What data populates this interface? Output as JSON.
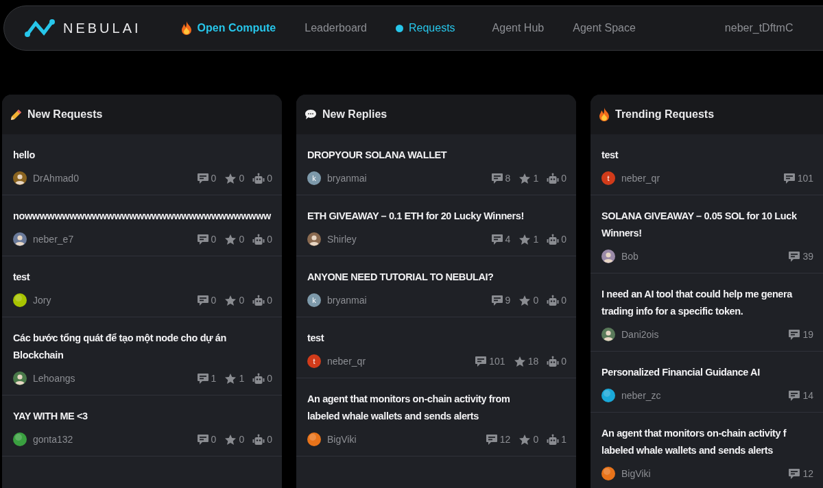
{
  "nav": {
    "brand": "NEBULAI",
    "items": [
      {
        "label": "Open Compute",
        "kind": "promo",
        "selected": false
      },
      {
        "label": "Leaderboard",
        "kind": "link",
        "selected": false
      },
      {
        "label": "Requests",
        "kind": "link",
        "selected": true
      },
      {
        "label": "Agent Hub",
        "kind": "link",
        "selected": false
      },
      {
        "label": "Agent Space",
        "kind": "link",
        "selected": false
      }
    ],
    "user": "neber_tDftmC"
  },
  "columns": [
    {
      "title": "New Requests",
      "posts": [
        {
          "lines": [
            "hello"
          ],
          "author": "DrAhmad0",
          "avatar": {
            "kind": "photo",
            "color": "#8a6420"
          },
          "comments": "0",
          "likes": "0",
          "agents": "0"
        },
        {
          "lines": [
            "nowwwwwwwwwwwwwwwwwwwwwwwwwwwwwwwww"
          ],
          "author": "neber_e7",
          "avatar": {
            "kind": "photo",
            "color": "#6a7a9a"
          },
          "comments": "0",
          "likes": "0",
          "agents": "0"
        },
        {
          "lines": [
            "test"
          ],
          "author": "Jory",
          "avatar": {
            "kind": "gradient",
            "color": "#a8c400"
          },
          "comments": "0",
          "likes": "0",
          "agents": "0"
        },
        {
          "lines": [
            "Các bước tổng quát để tạo một node cho dự án",
            "Blockchain"
          ],
          "author": "Lehoangs",
          "avatar": {
            "kind": "photo",
            "color": "#4a7a4a"
          },
          "comments": "1",
          "likes": "1",
          "agents": "0"
        },
        {
          "lines": [
            "YAY WITH ME <3"
          ],
          "author": "gonta132",
          "avatar": {
            "kind": "gradient",
            "color": "#3aa040"
          },
          "comments": "0",
          "likes": "0",
          "agents": "0"
        }
      ]
    },
    {
      "title": "New Replies",
      "posts": [
        {
          "lines": [
            "DROPYOUR SOLANA WALLET"
          ],
          "author": "bryanmai",
          "avatar": {
            "kind": "letter",
            "letter": "k",
            "color": "#7d99aa"
          },
          "comments": "8",
          "likes": "1",
          "agents": "0"
        },
        {
          "lines": [
            "ETH GIVEAWAY – 0.1 ETH for 20 Lucky Winners!"
          ],
          "author": "Shirley",
          "avatar": {
            "kind": "photo",
            "color": "#8a6a50"
          },
          "comments": "4",
          "likes": "1",
          "agents": "0"
        },
        {
          "lines": [
            "ANYONE NEED TUTORIAL TO NEBULAI?"
          ],
          "author": "bryanmai",
          "avatar": {
            "kind": "letter",
            "letter": "k",
            "color": "#7d99aa"
          },
          "comments": "9",
          "likes": "0",
          "agents": "0"
        },
        {
          "lines": [
            "test"
          ],
          "author": "neber_qr",
          "avatar": {
            "kind": "letter",
            "letter": "t",
            "color": "#d13b1a"
          },
          "comments": "101",
          "likes": "18",
          "agents": "0"
        },
        {
          "lines": [
            "An agent that monitors on-chain activity from",
            "labeled whale wallets and sends alerts"
          ],
          "author": "BigViki",
          "avatar": {
            "kind": "gradient",
            "color": "#e8731a"
          },
          "comments": "12",
          "likes": "0",
          "agents": "1"
        }
      ]
    },
    {
      "title": "Trending Requests",
      "posts": [
        {
          "lines": [
            "test"
          ],
          "author": "neber_qr",
          "avatar": {
            "kind": "letter",
            "letter": "t",
            "color": "#d13b1a"
          },
          "comments": "101"
        },
        {
          "lines": [
            "SOLANA GIVEAWAY – 0.05 SOL for 10 Luck",
            "Winners!"
          ],
          "author": "Bob",
          "avatar": {
            "kind": "photo",
            "color": "#9a8aa8"
          },
          "comments": "39"
        },
        {
          "lines": [
            "I need an AI tool that could help me genera",
            "trading info for a specific token."
          ],
          "author": "Dani2ois",
          "avatar": {
            "kind": "photo",
            "color": "#5a7a5a"
          },
          "comments": "19"
        },
        {
          "lines": [
            "Personalized Financial Guidance AI"
          ],
          "author": "neber_zc",
          "avatar": {
            "kind": "gradient",
            "color": "#1aa8d8"
          },
          "comments": "14"
        },
        {
          "lines": [
            "An agent that monitors on-chain activity f",
            "labeled whale wallets and sends alerts"
          ],
          "author": "BigViki",
          "avatar": {
            "kind": "gradient",
            "color": "#e8731a"
          },
          "comments": "12"
        }
      ]
    }
  ]
}
